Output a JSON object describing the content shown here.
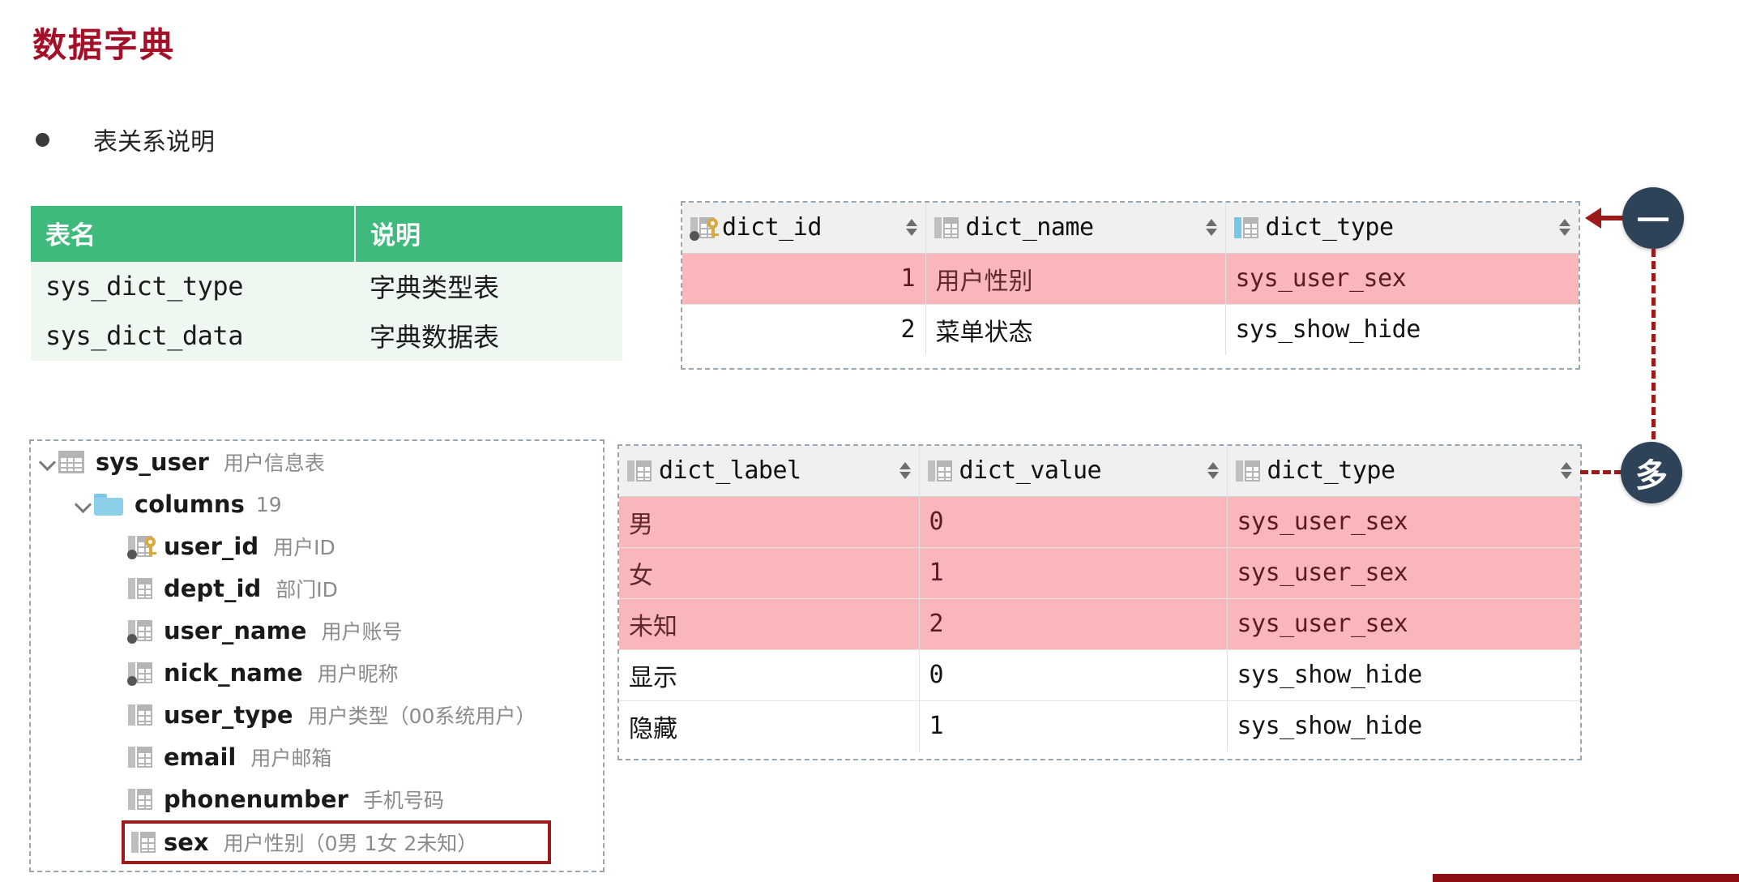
{
  "page": {
    "title": "数据字典",
    "bullet": "表关系说明",
    "accent_red": "#a41027",
    "green": "#3fba7d",
    "highlight_pink": "#f9b6bb",
    "badge_navy": "#2e4258",
    "connector_red": "#9c1a1a"
  },
  "table_legend": {
    "headers": [
      "表名",
      "说明"
    ],
    "rows": [
      {
        "name": "sys_dict_type",
        "desc": "字典类型表"
      },
      {
        "name": "sys_dict_data",
        "desc": "字典数据表"
      }
    ]
  },
  "dict_type_grid": {
    "columns": [
      {
        "name": "dict_id",
        "icon": "column-key-icon",
        "sortable": true
      },
      {
        "name": "dict_name",
        "icon": "column-icon",
        "sortable": true
      },
      {
        "name": "dict_type",
        "icon": "column-blue-icon",
        "sortable": true
      }
    ],
    "rows": [
      {
        "dict_id": "1",
        "dict_name": "用户性别",
        "dict_type": "sys_user_sex",
        "highlighted": true
      },
      {
        "dict_id": "2",
        "dict_name": "菜单状态",
        "dict_type": "sys_show_hide",
        "highlighted": false
      }
    ]
  },
  "dict_data_grid": {
    "columns": [
      {
        "name": "dict_label",
        "icon": "column-icon",
        "sortable": true
      },
      {
        "name": "dict_value",
        "icon": "column-icon",
        "sortable": true
      },
      {
        "name": "dict_type",
        "icon": "column-icon",
        "sortable": true
      }
    ],
    "rows": [
      {
        "dict_label": "男",
        "dict_value": "0",
        "dict_type": "sys_user_sex",
        "highlighted": true
      },
      {
        "dict_label": "女",
        "dict_value": "1",
        "dict_type": "sys_user_sex",
        "highlighted": true
      },
      {
        "dict_label": "未知",
        "dict_value": "2",
        "dict_type": "sys_user_sex",
        "highlighted": true
      },
      {
        "dict_label": "显示",
        "dict_value": "0",
        "dict_type": "sys_show_hide",
        "highlighted": false
      },
      {
        "dict_label": "隐藏",
        "dict_value": "1",
        "dict_type": "sys_show_hide",
        "highlighted": false
      }
    ]
  },
  "tree": {
    "root": {
      "name": "sys_user",
      "desc": "用户信息表",
      "icon": "table-icon",
      "expanded": true
    },
    "folder": {
      "name": "columns",
      "count": "19",
      "icon": "folder-icon",
      "expanded": true
    },
    "columns": [
      {
        "name": "user_id",
        "desc": "用户ID",
        "icon": "column-key-icon"
      },
      {
        "name": "dept_id",
        "desc": "部门ID",
        "icon": "column-icon"
      },
      {
        "name": "user_name",
        "desc": "用户账号",
        "icon": "column-dot-icon"
      },
      {
        "name": "nick_name",
        "desc": "用户昵称",
        "icon": "column-dot-icon"
      },
      {
        "name": "user_type",
        "desc": "用户类型（00系统用户）",
        "icon": "column-icon"
      },
      {
        "name": "email",
        "desc": "用户邮箱",
        "icon": "column-icon"
      },
      {
        "name": "phonenumber",
        "desc": "手机号码",
        "icon": "column-icon"
      },
      {
        "name": "sex",
        "desc": "用户性别（0男 1女 2未知）",
        "icon": "column-icon",
        "highlighted": true
      }
    ]
  },
  "relations": {
    "one_badge": "一",
    "many_badge": "多"
  }
}
